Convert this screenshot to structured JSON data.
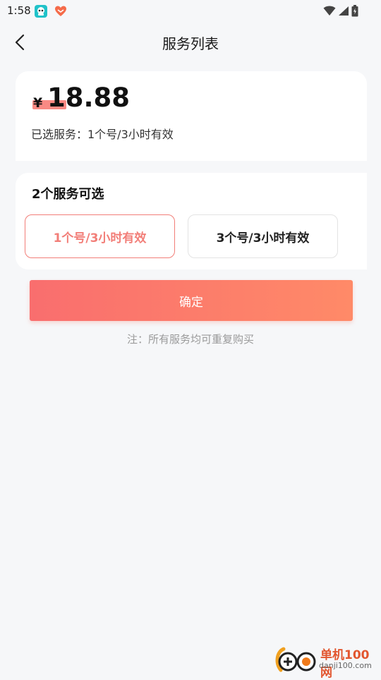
{
  "status_bar": {
    "time": "1:58"
  },
  "nav": {
    "title": "服务列表"
  },
  "price": {
    "currency": "¥",
    "amount": "18.88",
    "selected_text": "已选服务：1个号/3小时有效"
  },
  "options": {
    "title": "2个服务可选",
    "items": [
      {
        "label": "1个号/3小时有效",
        "selected": true
      },
      {
        "label": "3个号/3小时有效",
        "selected": false
      }
    ]
  },
  "confirm": {
    "label": "确定"
  },
  "note": {
    "text": "注：所有服务均可重复购买"
  },
  "watermark": {
    "text": "单机100网",
    "url": "danji100.com"
  },
  "colors": {
    "accent": "#f27e78",
    "button_start": "#f96e6e",
    "button_end": "#ff8a68",
    "background": "#f6f7f9"
  },
  "icons": [
    "back-arrow-icon",
    "wifi-icon",
    "signal-icon",
    "battery-icon",
    "app-icon-game",
    "app-icon-heart"
  ]
}
